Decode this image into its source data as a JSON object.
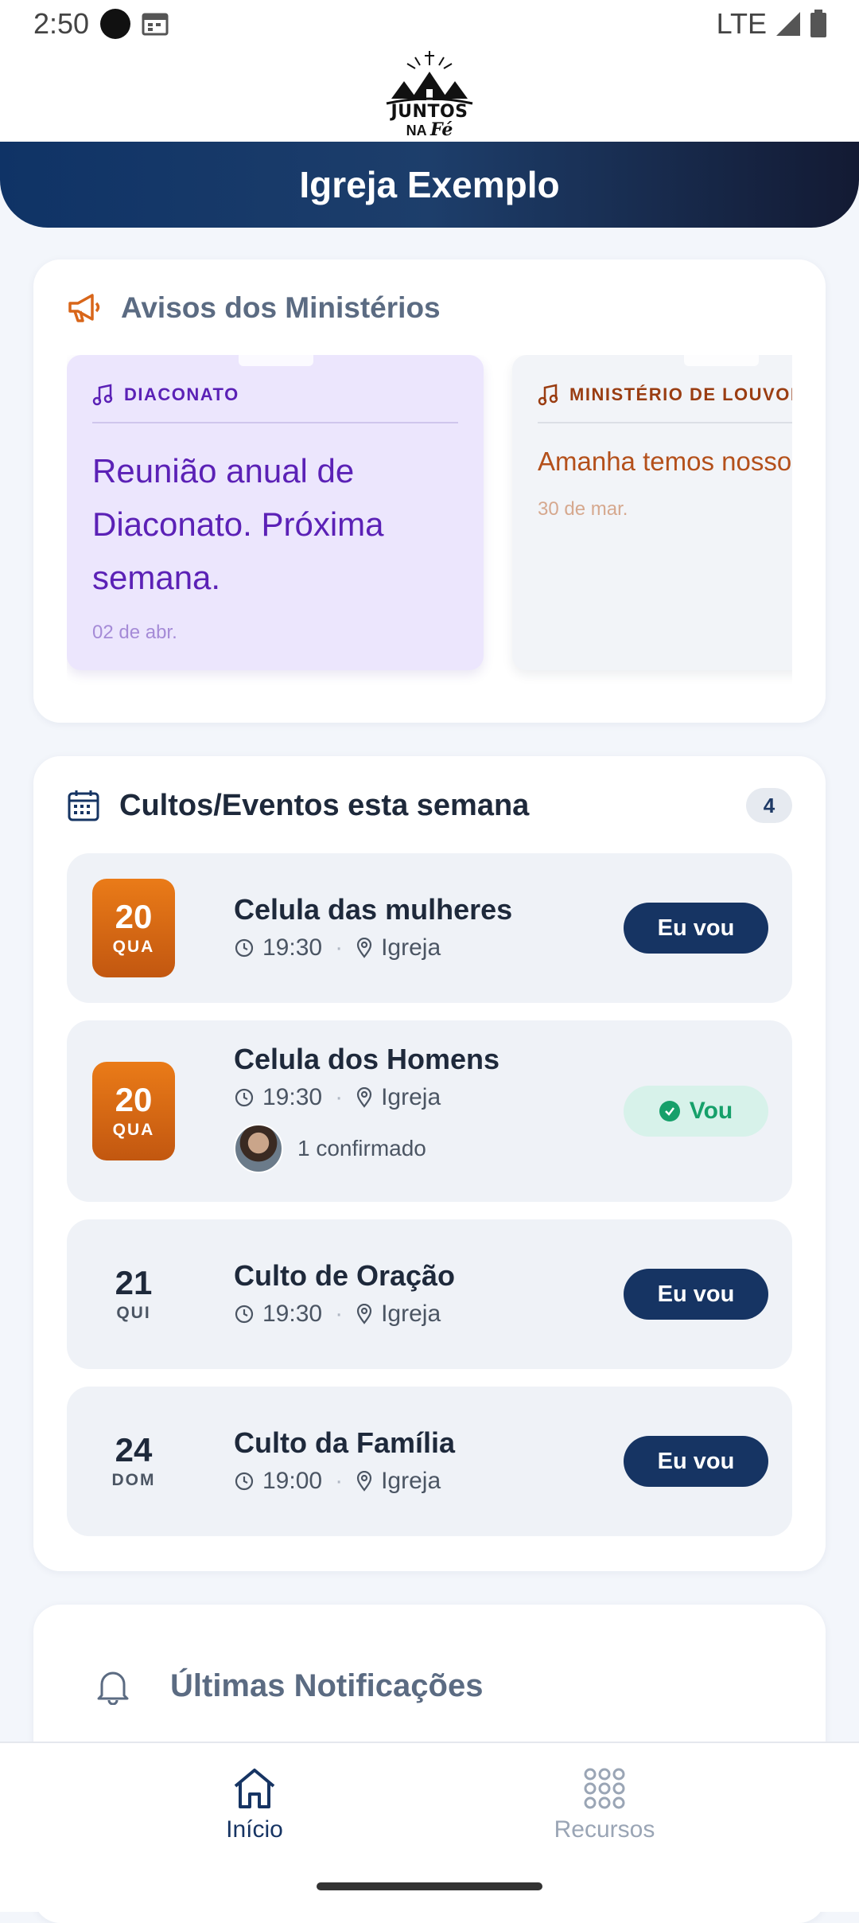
{
  "status": {
    "time": "2:50",
    "network": "LTE"
  },
  "app": {
    "logo_line1": "JUNTOS",
    "logo_line2": "NA",
    "logo_line3": "Fé",
    "church_name": "Igreja Exemplo"
  },
  "notices": {
    "title": "Avisos dos Ministérios",
    "items": [
      {
        "ministry": "DIACONATO",
        "text": "Reunião anual de Diaconato. Próxima semana.",
        "date": "02 de abr."
      },
      {
        "ministry": "MINISTÉRIO DE LOUVOR",
        "text": "Amanha temos nosso",
        "date": "30 de mar."
      }
    ]
  },
  "events": {
    "title": "Cultos/Eventos esta semana",
    "count": "4",
    "items": [
      {
        "day": "20",
        "weekday": "QUA",
        "name": "Celula das mulheres",
        "time": "19:30",
        "place": "Igreja",
        "action": "Eu vou"
      },
      {
        "day": "20",
        "weekday": "QUA",
        "name": "Celula dos Homens",
        "time": "19:30",
        "place": "Igreja",
        "action": "Vou",
        "confirmed": "1 confirmado"
      },
      {
        "day": "21",
        "weekday": "QUI",
        "name": "Culto de Oração",
        "time": "19:30",
        "place": "Igreja",
        "action": "Eu vou"
      },
      {
        "day": "24",
        "weekday": "DOM",
        "name": "Culto da Família",
        "time": "19:00",
        "place": "Igreja",
        "action": "Eu vou"
      }
    ]
  },
  "notifications": {
    "title": "Últimas Notificações"
  },
  "nav": {
    "home": "Início",
    "resources": "Recursos"
  },
  "colors": {
    "primary": "#163463",
    "accent_orange": "#d8661a",
    "success": "#16a06a",
    "notice_purple": "#5b21b6"
  }
}
